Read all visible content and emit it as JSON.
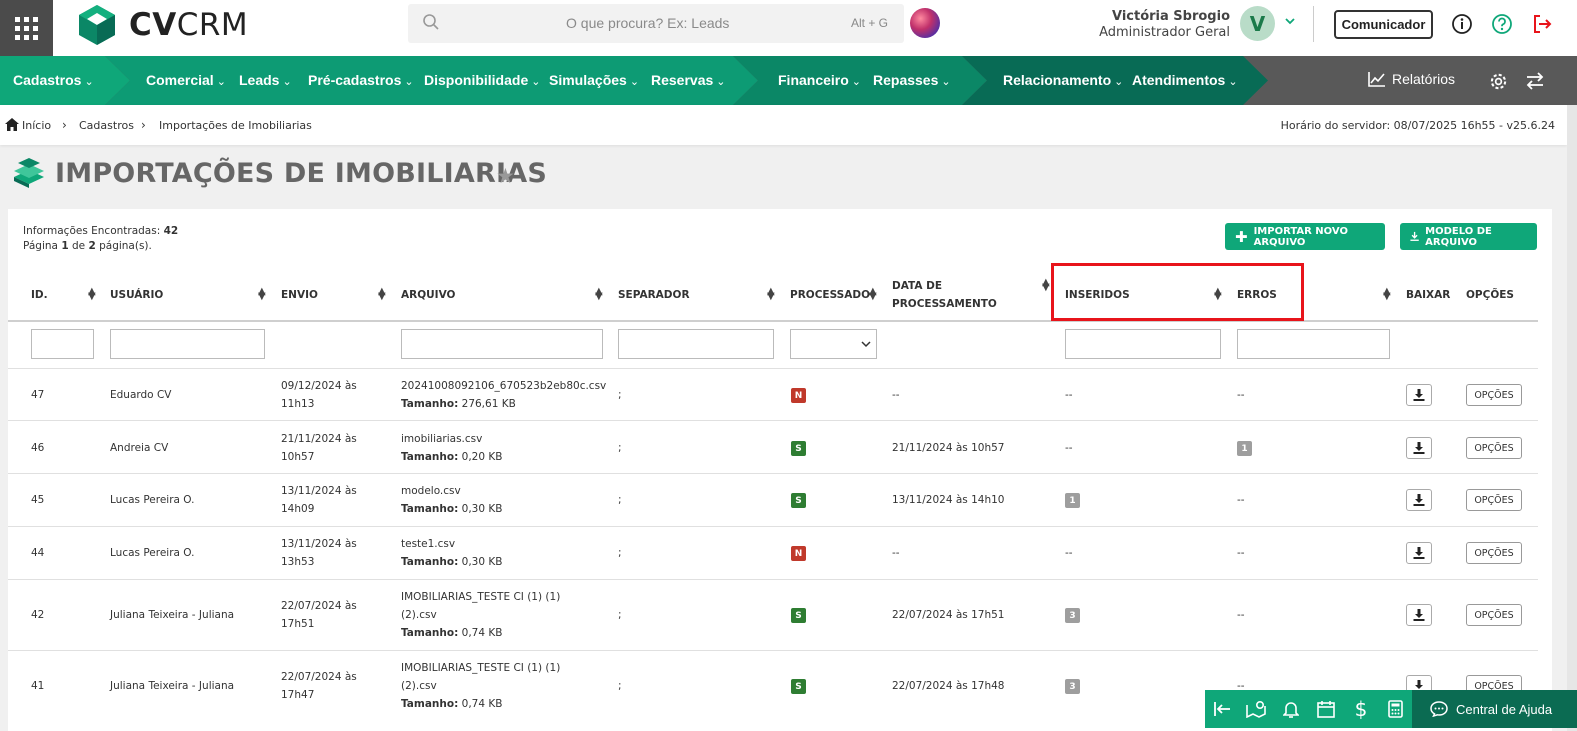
{
  "brand": {
    "cv": "CV",
    "crm": "CRM"
  },
  "search": {
    "placeholder": "O que procura? Ex: Leads",
    "shortcut": "Alt + G"
  },
  "user": {
    "name": "Victória Sbrogio",
    "role": "Administrador Geral",
    "initial": "V"
  },
  "header": {
    "communicator": "Comunicador"
  },
  "nav": {
    "items": [
      "Cadastros",
      "Comercial",
      "Leads",
      "Pré-cadastros",
      "Disponibilidade",
      "Simulações",
      "Reservas",
      "Financeiro",
      "Repasses",
      "Relacionamento",
      "Atendimentos"
    ],
    "reports": "Relatórios",
    "colors": {
      "seg1": "#0fa779",
      "seg2": "#0d9b74",
      "seg3": "#0b8766",
      "seg4": "#086b55",
      "rest": "#595959"
    }
  },
  "breadcrumb": {
    "home": "Início",
    "section": "Cadastros",
    "page": "Importações de Imobiliarias"
  },
  "server_time": "Horário do servidor: 08/07/2025 16h55 - v25.6.24",
  "page_title": "IMPORTAÇÕES DE IMOBILIARIAS",
  "summary": {
    "found_label": "Informações Encontradas:",
    "found_value": "42",
    "page_prefix": "Página",
    "page_current": "1",
    "page_of": "de",
    "page_total": "2",
    "page_suffix": "página(s)."
  },
  "actions": {
    "import": "IMPORTAR NOVO ARQUIVO",
    "template": "MODELO DE ARQUIVO"
  },
  "table": {
    "headers": {
      "id": "ID.",
      "user": "USUÁRIO",
      "sent": "ENVIO",
      "file": "ARQUIVO",
      "sep": "SEPARADOR",
      "processed": "PROCESSADO",
      "proc_date_1": "DATA DE",
      "proc_date_2": "PROCESSAMENTO",
      "inserted": "INSERIDOS",
      "errors": "ERROS",
      "download": "BAIXAR",
      "options": "OPÇÕES"
    },
    "rows": [
      {
        "id": "47",
        "user": "Eduardo CV",
        "sent1": "09/12/2024 às",
        "sent2": "11h13",
        "file1": "20241008092106_670523b2eb80c.csv",
        "file2": "",
        "size": "276,61 KB",
        "sep": ";",
        "processed": "N",
        "proc_date": "--",
        "inserted": "--",
        "errors": "--"
      },
      {
        "id": "46",
        "user": "Andreia CV",
        "sent1": "21/11/2024 às",
        "sent2": "10h57",
        "file1": "imobiliarias.csv",
        "file2": "",
        "size": "0,20 KB",
        "sep": ";",
        "processed": "S",
        "proc_date": "21/11/2024 às 10h57",
        "inserted": "--",
        "errors": "1"
      },
      {
        "id": "45",
        "user": "Lucas Pereira O.",
        "sent1": "13/11/2024 às",
        "sent2": "14h09",
        "file1": "modelo.csv",
        "file2": "",
        "size": "0,30 KB",
        "sep": ";",
        "processed": "S",
        "proc_date": "13/11/2024 às 14h10",
        "inserted": "1",
        "errors": "--"
      },
      {
        "id": "44",
        "user": "Lucas Pereira O.",
        "sent1": "13/11/2024 às",
        "sent2": "13h53",
        "file1": "teste1.csv",
        "file2": "",
        "size": "0,30 KB",
        "sep": ";",
        "processed": "N",
        "proc_date": "--",
        "inserted": "--",
        "errors": "--"
      },
      {
        "id": "42",
        "user": "Juliana Teixeira - Juliana",
        "sent1": "22/07/2024 às",
        "sent2": "17h51",
        "file1": "IMOBILIARIAS_TESTE CI (1) (1)",
        "file2": "(2).csv",
        "size": "0,74 KB",
        "sep": ";",
        "processed": "S",
        "proc_date": "22/07/2024 às 17h51",
        "inserted": "3",
        "errors": "--"
      },
      {
        "id": "41",
        "user": "Juliana Teixeira - Juliana",
        "sent1": "22/07/2024 às",
        "sent2": "17h47",
        "file1": "IMOBILIARIAS_TESTE CI (1) (1)",
        "file2": "(2).csv",
        "size": "0,74 KB",
        "sep": ";",
        "processed": "S",
        "proc_date": "22/07/2024 às 17h48",
        "inserted": "3",
        "errors": "--"
      }
    ],
    "size_label": "Tamanho:",
    "options_label": "OPÇÕES"
  },
  "footer": {
    "help": "Central de Ajuda"
  }
}
